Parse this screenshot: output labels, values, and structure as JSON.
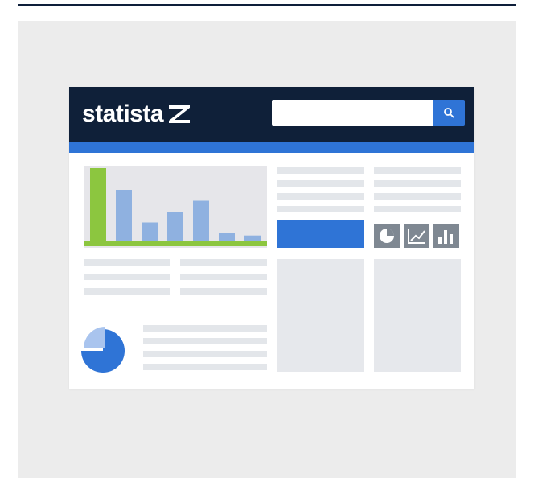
{
  "brand": {
    "name": "statista",
    "header_color": "#0f2039",
    "accent": "#2f74d6"
  },
  "search": {
    "placeholder": "",
    "value": "",
    "button_icon": "search-icon"
  },
  "chart_data": {
    "type": "bar",
    "title": "",
    "categories": [
      "",
      "",
      "",
      "",
      "",
      "",
      ""
    ],
    "series": [
      {
        "values": [
          100,
          70,
          25,
          40,
          55,
          10,
          7
        ]
      }
    ],
    "colors": [
      "#8cc63f",
      "#8fb1e0",
      "#8fb1e0",
      "#8fb1e0",
      "#8fb1e0",
      "#8fb1e0",
      "#8fb1e0"
    ],
    "baseline_color": "#8cc63f",
    "ylim": [
      0,
      100
    ],
    "grid": false
  },
  "pie_chart": {
    "type": "pie",
    "values": [
      75,
      25
    ],
    "colors": [
      "#2f74d6",
      "#a9c4ee"
    ]
  },
  "chart_type_buttons": [
    "pie-chart-icon",
    "line-chart-icon",
    "bar-chart-icon"
  ]
}
